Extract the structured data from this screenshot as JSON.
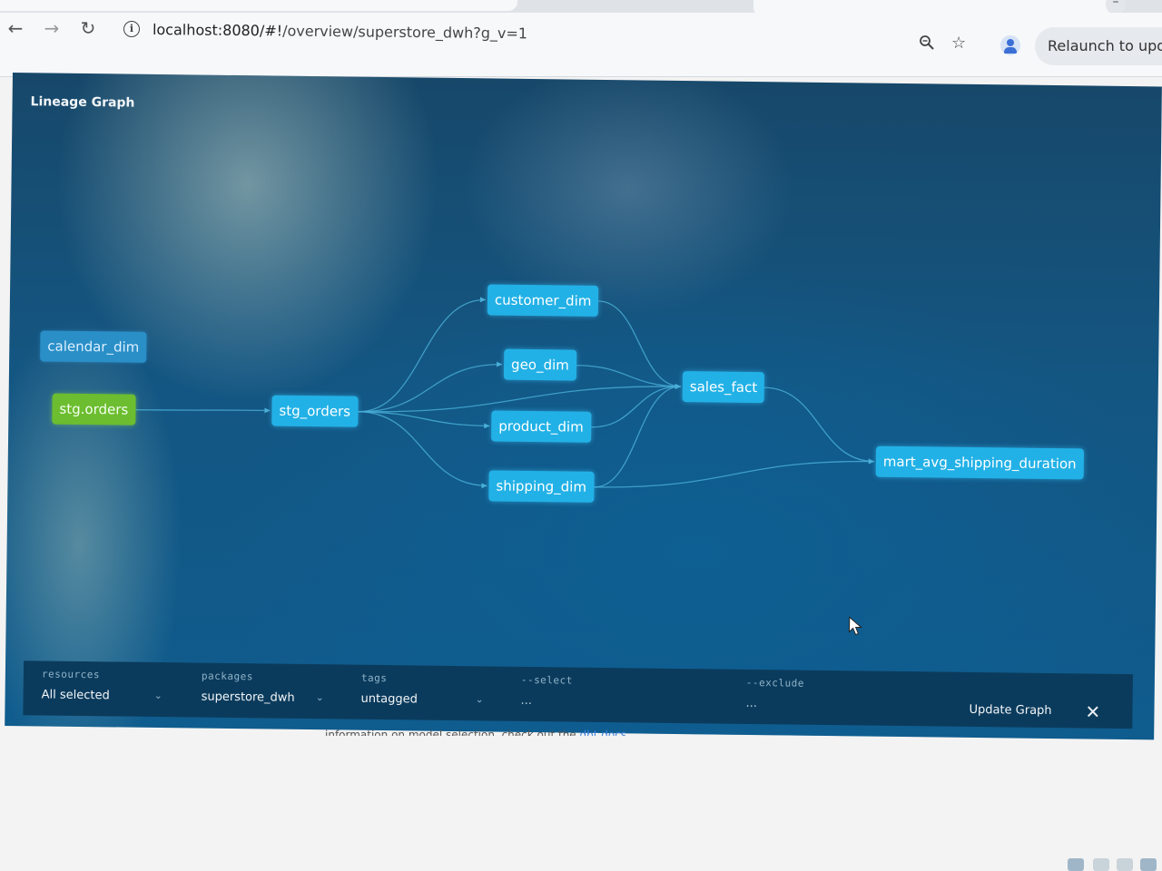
{
  "browser": {
    "url_host": "localhost:8080/#!",
    "url_path": "/overview/superstore_dwh?g_v=1",
    "relaunch_label": "Relaunch to upda",
    "minimize_label": "–"
  },
  "panel": {
    "title": "Lineage Graph"
  },
  "graph": {
    "nodes": [
      {
        "id": "calendar_dim",
        "label": "calendar_dim",
        "kind": "model-dim"
      },
      {
        "id": "stg_orders_source",
        "label": "stg.orders",
        "kind": "source"
      },
      {
        "id": "stg_orders",
        "label": "stg_orders",
        "kind": "model"
      },
      {
        "id": "customer_dim",
        "label": "customer_dim",
        "kind": "model"
      },
      {
        "id": "geo_dim",
        "label": "geo_dim",
        "kind": "model"
      },
      {
        "id": "product_dim",
        "label": "product_dim",
        "kind": "model"
      },
      {
        "id": "shipping_dim",
        "label": "shipping_dim",
        "kind": "model"
      },
      {
        "id": "sales_fact",
        "label": "sales_fact",
        "kind": "model"
      },
      {
        "id": "mart_avg_shipping_duration",
        "label": "mart_avg_shipping_duration",
        "kind": "model"
      }
    ],
    "edges": [
      [
        "stg_orders_source",
        "stg_orders"
      ],
      [
        "stg_orders",
        "customer_dim"
      ],
      [
        "stg_orders",
        "geo_dim"
      ],
      [
        "stg_orders",
        "product_dim"
      ],
      [
        "stg_orders",
        "shipping_dim"
      ],
      [
        "stg_orders",
        "sales_fact"
      ],
      [
        "customer_dim",
        "sales_fact"
      ],
      [
        "geo_dim",
        "sales_fact"
      ],
      [
        "product_dim",
        "sales_fact"
      ],
      [
        "shipping_dim",
        "sales_fact"
      ],
      [
        "sales_fact",
        "mart_avg_shipping_duration"
      ],
      [
        "shipping_dim",
        "mart_avg_shipping_duration"
      ]
    ],
    "colors": {
      "model": "#22b1e6",
      "source": "#6cbd2f",
      "edge": "#4ab0d8"
    }
  },
  "filters": {
    "resources": {
      "label": "resources",
      "value": "All selected"
    },
    "packages": {
      "label": "packages",
      "value": "superstore_dwh"
    },
    "tags": {
      "label": "tags",
      "value": "untagged"
    },
    "select": {
      "label": "--select",
      "value": "..."
    },
    "exclude": {
      "label": "--exclude",
      "value": "..."
    },
    "update_label": "Update Graph",
    "close_label": "✕"
  },
  "behind": {
    "text": "information on model selection, check out the ",
    "link": "dbt docs"
  },
  "icons": {
    "back": "arrow-left-icon",
    "forward": "arrow-right-icon",
    "reload": "reload-icon",
    "info": "info-icon",
    "zoom": "zoom-icon",
    "bookmark": "star-icon",
    "profile": "avatar-icon",
    "close": "close-icon",
    "dropdown": "chevron-down-icon",
    "cursor": "mouse-pointer-icon"
  }
}
